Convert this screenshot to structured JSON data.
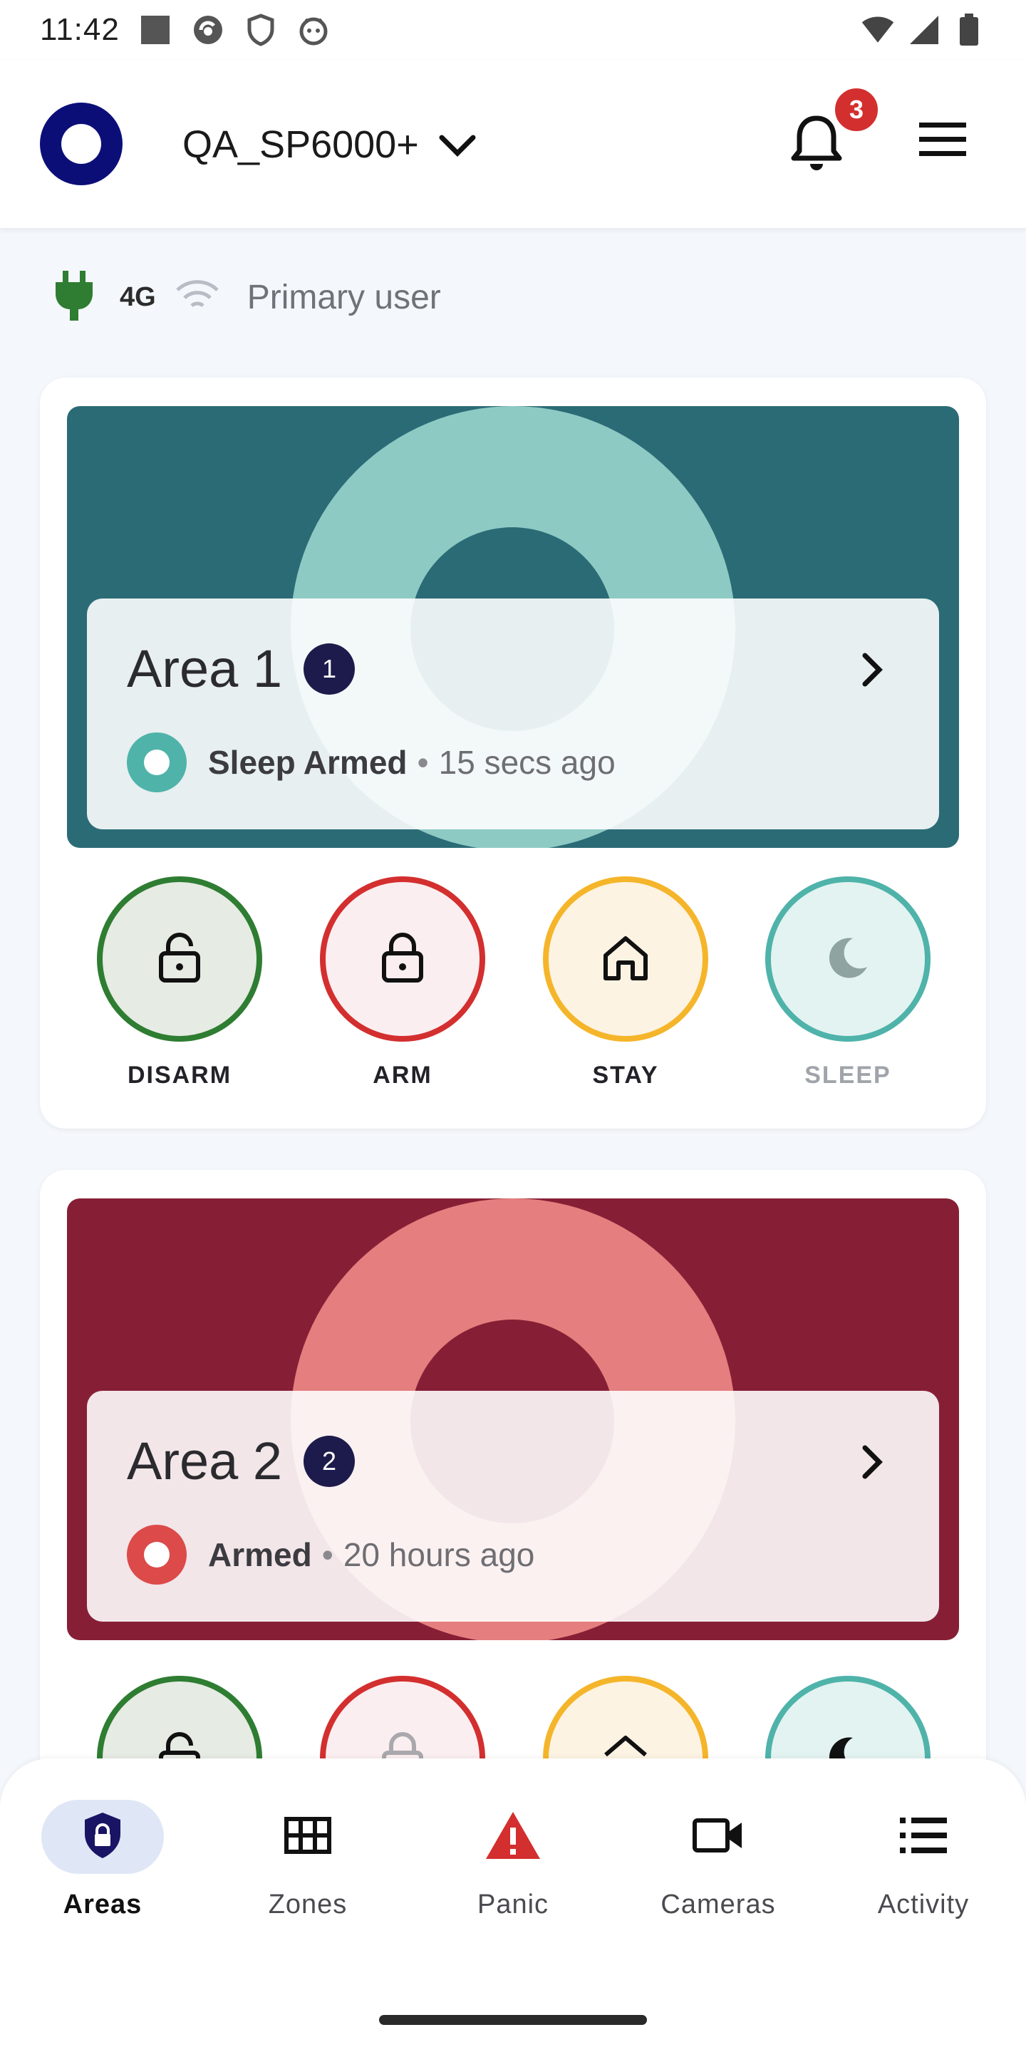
{
  "status_bar": {
    "time": "11:42"
  },
  "header": {
    "site_name": "QA_SP6000+",
    "notification_count": "3"
  },
  "connection": {
    "network": "4G",
    "user_role": "Primary user"
  },
  "areas": [
    {
      "name": "Area 1",
      "number": "1",
      "status": "Sleep Armed",
      "separator": "•",
      "time_ago": "15 secs ago",
      "color": "#2b6b76"
    },
    {
      "name": "Area 2",
      "number": "2",
      "status": "Armed",
      "separator": "•",
      "time_ago": "20 hours ago",
      "color": "#861f35"
    }
  ],
  "actions": {
    "disarm": "DISARM",
    "arm": "ARM",
    "stay": "STAY",
    "sleep": "SLEEP"
  },
  "nav": {
    "areas": "Areas",
    "zones": "Zones",
    "panic": "Panic",
    "cameras": "Cameras",
    "activity": "Activity"
  }
}
